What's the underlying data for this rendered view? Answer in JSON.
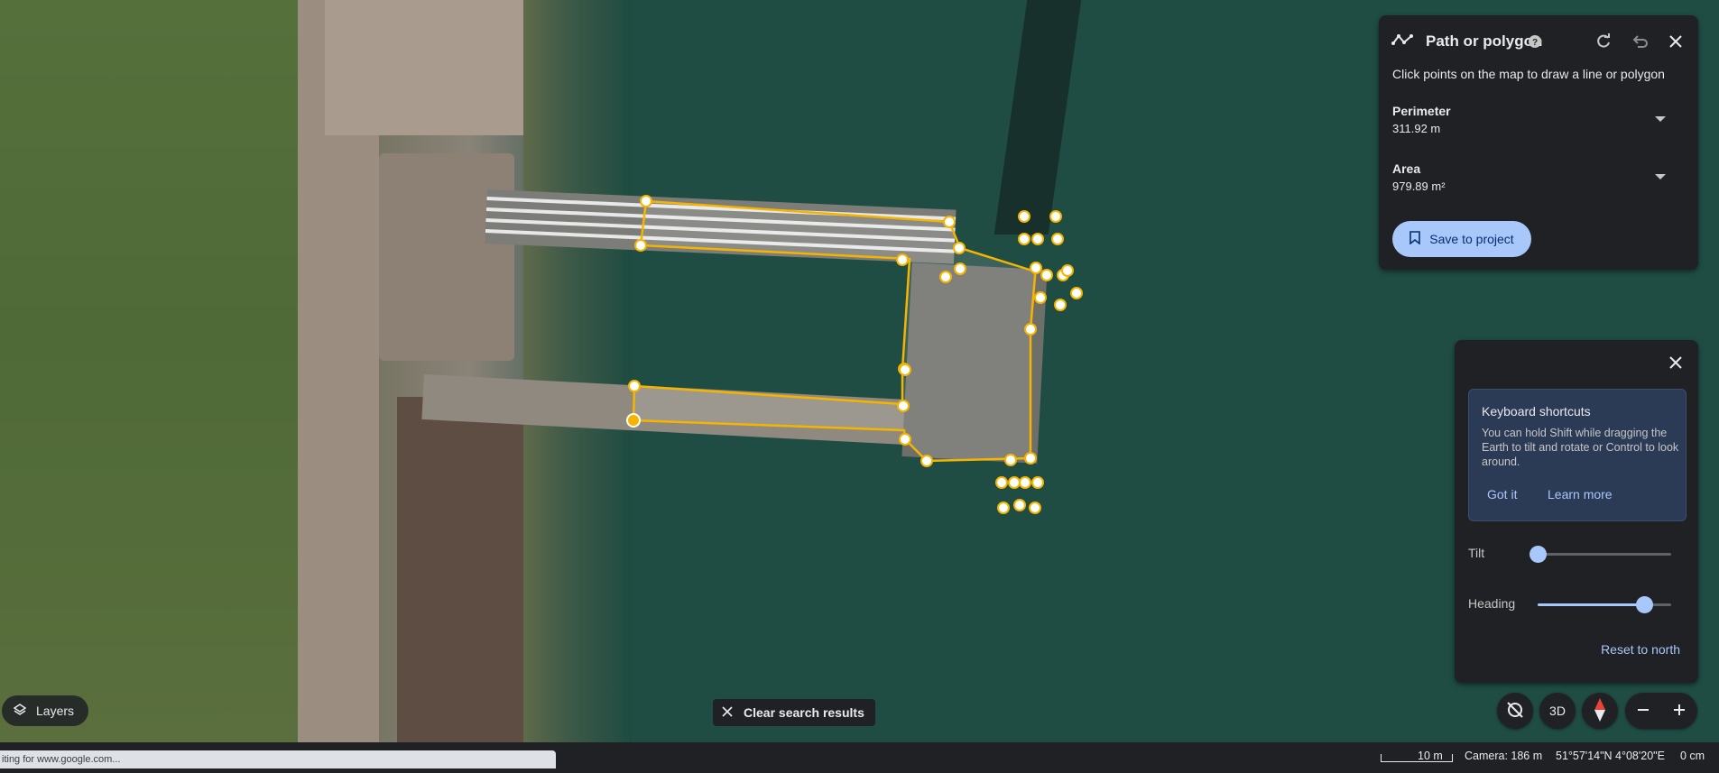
{
  "path_panel": {
    "title": "Path or polygon",
    "hint": "Click points on the map to draw a line or polygon",
    "perimeter_label": "Perimeter",
    "perimeter_value": "311.92 m",
    "area_label": "Area",
    "area_value": "979.89 m²",
    "save_label": "Save to project"
  },
  "shortcuts_panel": {
    "title": "Keyboard shortcuts",
    "body": "You can hold Shift while dragging the Earth to tilt and rotate or Control to look around.",
    "got_it": "Got it",
    "learn_more": "Learn more",
    "tilt_label": "Tilt",
    "tilt_level": 0.0,
    "heading_label": "Heading",
    "heading_level": 0.8,
    "reset_label": "Reset to north"
  },
  "controls": {
    "layers_label": "Layers",
    "clear_label": "Clear search results",
    "three_d_label": "3D"
  },
  "status": {
    "loading_text": "iting for www.google.com...",
    "scale_text": "10 m",
    "camera_text": "Camera: 186 m",
    "coords_text": "51°57'14\"N 4°08'20\"E",
    "dist_text": "0 cm"
  },
  "colors": {
    "polygon": "#f4b400",
    "accent": "#a8c7fa",
    "panel": "#202124"
  },
  "icons": [
    "path-icon",
    "help-icon",
    "redo-icon",
    "undo-icon",
    "close-icon",
    "bookmark-icon",
    "layers-icon",
    "compass-icon",
    "zoom-in-icon",
    "zoom-out-icon",
    "rotate-icon"
  ]
}
